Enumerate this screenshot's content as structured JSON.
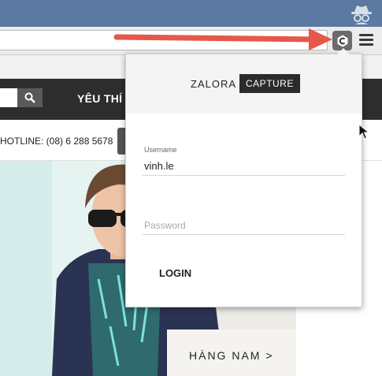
{
  "browser": {
    "toolbar_icons": [
      "incognito-icon",
      "capture-extension-icon",
      "menu-icon"
    ]
  },
  "site": {
    "nav_label": "YÊU THÍ",
    "hotline": "HOTLINE: (08) 6 288 5678",
    "hero_cta": "HÀNG NAM >"
  },
  "popup": {
    "brand_name": "ZALORA",
    "brand_badge": "CAPTURE",
    "username_label": "Username",
    "username_value": "vinh.le",
    "password_placeholder": "Password",
    "login_label": "LOGIN"
  },
  "colors": {
    "annotation_arrow": "#e5584a",
    "site_header": "#2d2d2d",
    "browser_titlebar": "#5b79a1"
  }
}
